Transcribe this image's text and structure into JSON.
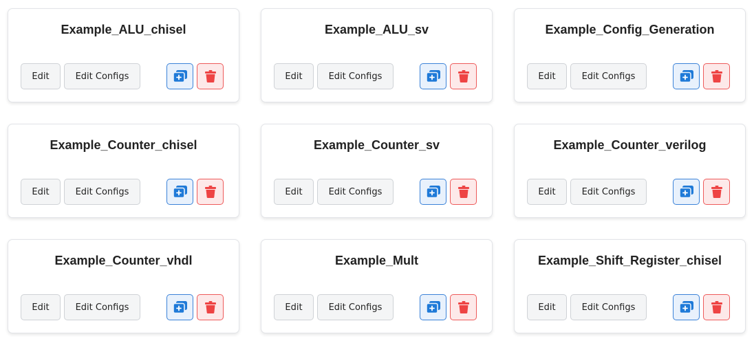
{
  "labels": {
    "edit": "Edit",
    "edit_configs": "Edit Configs"
  },
  "colors": {
    "clone_accent": "#1f7ad8",
    "delete_accent": "#ee4444"
  },
  "icons": {
    "clone": "copy-plus-icon",
    "delete": "trash-icon"
  },
  "projects": [
    {
      "name": "Example_ALU_chisel"
    },
    {
      "name": "Example_ALU_sv"
    },
    {
      "name": "Example_Config_Generation"
    },
    {
      "name": "Example_Counter_chisel"
    },
    {
      "name": "Example_Counter_sv"
    },
    {
      "name": "Example_Counter_verilog"
    },
    {
      "name": "Example_Counter_vhdl"
    },
    {
      "name": "Example_Mult"
    },
    {
      "name": "Example_Shift_Register_chisel"
    }
  ]
}
